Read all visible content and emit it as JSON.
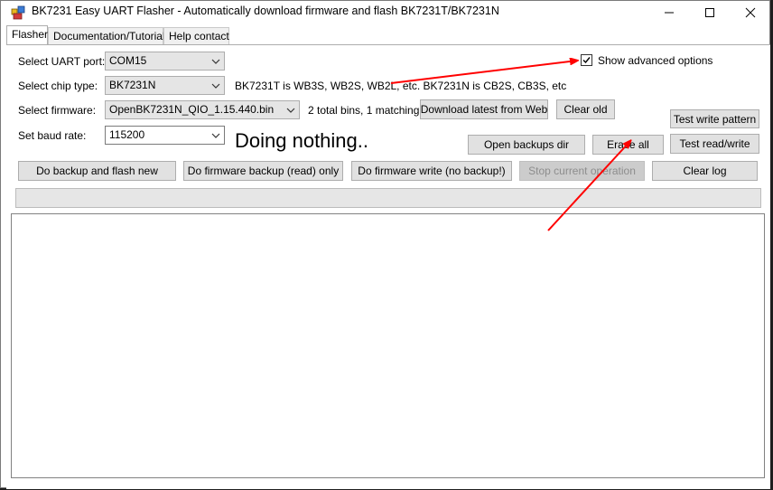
{
  "window": {
    "title": "BK7231 Easy UART Flasher - Automatically download firmware and flash BK7231T/BK7231N",
    "icon": "app-icon",
    "controls": {
      "minimize": "minimize-icon",
      "maximize": "maximize-icon",
      "close": "close-icon"
    }
  },
  "tabs": [
    {
      "label": "Flasher",
      "active": true
    },
    {
      "label": "Documentation/Tutorials",
      "active": false
    },
    {
      "label": "Help contact",
      "active": false
    }
  ],
  "form": {
    "uart_port": {
      "label": "Select UART port:",
      "value": "COM15"
    },
    "chip_type": {
      "label": "Select chip type:",
      "value": "BK7231N",
      "note": "BK7231T is WB3S, WB2S, WB2L, etc. BK7231N is CB2S, CB3S, etc"
    },
    "firmware": {
      "label": "Select firmware:",
      "value": "OpenBK7231N_QIO_1.15.440.bin",
      "note": "2 total bins, 1 matching."
    },
    "baud_rate": {
      "label": "Set baud rate:",
      "value": "115200"
    },
    "show_advanced": {
      "label": "Show advanced options",
      "checked": true
    }
  },
  "status_text": "Doing nothing..",
  "buttons": {
    "download_latest": "Download latest from Web",
    "clear_old": "Clear old",
    "test_write_pattern": "Test write pattern",
    "open_backups_dir": "Open backups dir",
    "erase_all": "Erase all",
    "test_read_write": "Test read/write",
    "backup_and_flash": "Do backup and flash new",
    "firmware_backup": "Do firmware backup (read) only",
    "firmware_write": "Do firmware write (no backup!)",
    "stop_operation": "Stop current operation",
    "clear_log": "Clear log"
  },
  "progress": 0,
  "log_text": "",
  "annotations": {
    "arrow_color": "#ff0000"
  }
}
